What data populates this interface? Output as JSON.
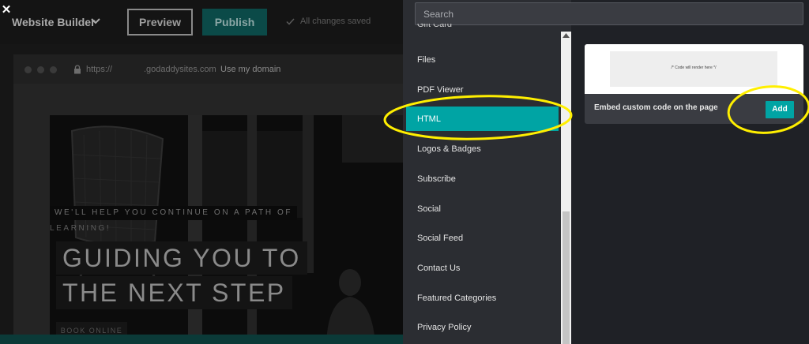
{
  "editor": {
    "close_glyph": "✕",
    "app_title": "Website Builder",
    "preview_label": "Preview",
    "publish_label": "Publish",
    "saved_status": "All changes saved"
  },
  "browser": {
    "url_scheme": "https://",
    "url_domain": ".godaddysites.com",
    "use_domain_link": "Use my domain"
  },
  "hero": {
    "tagline_line1": "WE'LL HELP YOU CONTINUE ON A PATH OF",
    "tagline_line2": "LEARNING!",
    "headline_line1": "GUIDING YOU TO",
    "headline_line2": "THE NEXT STEP",
    "cta_label": "BOOK ONLINE"
  },
  "panel": {
    "search_placeholder": "Search",
    "items": [
      {
        "label": "Gift Card"
      },
      {
        "label": "Files"
      },
      {
        "label": "PDF Viewer"
      },
      {
        "label": "HTML",
        "active": true
      },
      {
        "label": "Logos & Badges"
      },
      {
        "label": "Subscribe"
      },
      {
        "label": "Social"
      },
      {
        "label": "Social Feed"
      },
      {
        "label": "Contact Us"
      },
      {
        "label": "Featured Categories"
      },
      {
        "label": "Privacy Policy"
      }
    ]
  },
  "detail": {
    "code_placeholder": "/* Code will render here */",
    "description": "Embed custom code on the page",
    "add_label": "Add"
  },
  "colors": {
    "accent_teal": "#00a4a4",
    "highlight_yellow": "#ffef00",
    "panel_bg": "#2b2d32",
    "detail_bg": "#1f2126"
  }
}
